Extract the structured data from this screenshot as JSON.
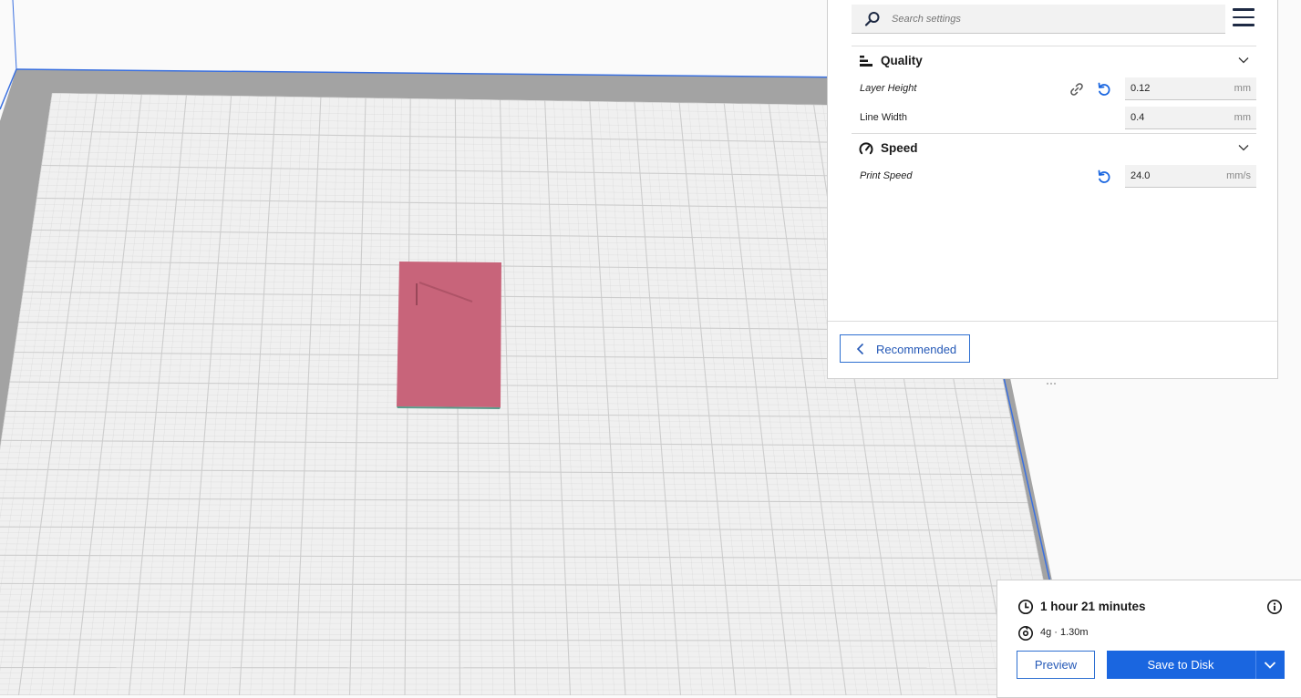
{
  "search": {
    "placeholder": "Search settings"
  },
  "categories": [
    {
      "label": "Quality",
      "icon": "quality-icon",
      "settings": [
        {
          "label": "Layer Height",
          "value": "0.12",
          "unit": "mm",
          "italic": true
        },
        {
          "label": "Line Width",
          "value": "0.4",
          "unit": "mm",
          "italic": false
        }
      ]
    },
    {
      "label": "Speed",
      "icon": "speed-icon",
      "settings": [
        {
          "label": "Print Speed",
          "value": "24.0",
          "unit": "mm/s",
          "italic": true
        }
      ]
    }
  ],
  "recommended_label": "Recommended",
  "print_info": {
    "time": "1 hour 21 minutes",
    "material": "4g · 1.30m",
    "preview_label": "Preview",
    "save_label": "Save to Disk"
  },
  "colors": {
    "accent": "#1a66e0",
    "model": "#c8647a",
    "build_plate": "#f2f2f2",
    "grid_line": "#cccccc",
    "disallowed_border": "#9a9a9a"
  }
}
